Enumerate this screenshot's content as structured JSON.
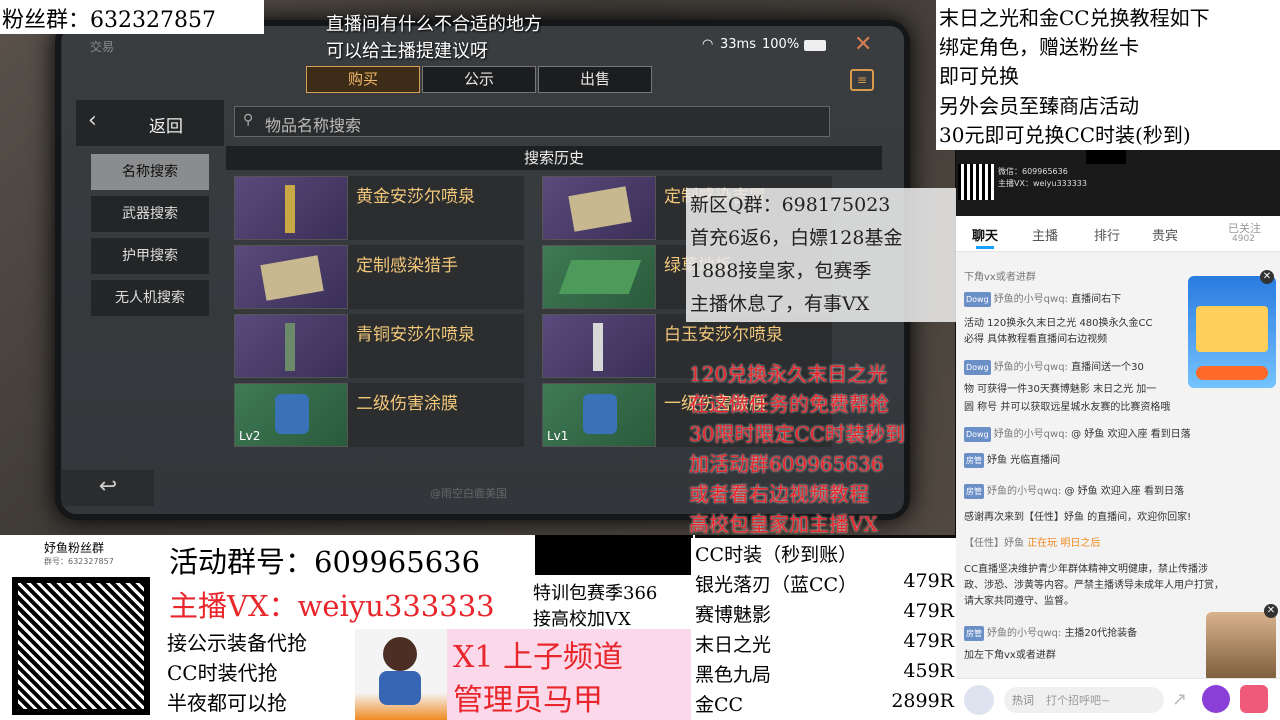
{
  "game": {
    "window_title": "交易",
    "ping": "33ms",
    "battery": "100%",
    "tabs": [
      {
        "label": "购买"
      },
      {
        "label": "公示"
      },
      {
        "label": "出售"
      }
    ],
    "back_label": "返回",
    "search_placeholder": "物品名称搜索",
    "history_title": "搜索历史",
    "side_items": [
      {
        "label": "名称搜索"
      },
      {
        "label": "武器搜索"
      },
      {
        "label": "护甲搜索"
      },
      {
        "label": "无人机搜索"
      }
    ],
    "items": [
      {
        "name": "黄金安莎尔喷泉",
        "level": ""
      },
      {
        "name": "定制感染吉冒",
        "level": ""
      },
      {
        "name": "定制感染猎手",
        "level": ""
      },
      {
        "name": "绿草地板",
        "level": ""
      },
      {
        "name": "青铜安莎尔喷泉",
        "level": ""
      },
      {
        "name": "白玉安莎尔喷泉",
        "level": ""
      },
      {
        "name": "二级伤害涂膜",
        "level": "Lv2"
      },
      {
        "name": "一级伤害涂膜",
        "level": "Lv1"
      }
    ],
    "bottom_hint": "@雨空白鹿美国"
  },
  "overlay": {
    "fan_group": "粉丝群：632327857",
    "top_notice": [
      "直播间有什么不合适的地方",
      "可以给主播提建议呀"
    ],
    "right_top": [
      "末日之光和金CC兑换教程如下",
      "绑定角色，赠送粉丝卡",
      "即可兑换",
      "另外会员至臻商店活动",
      "30元即可兑换CC时装(秒到)"
    ],
    "mid_block": [
      "新区Q群：698175023",
      "首充6返6，白嫖128基金",
      "1888接皇家，包赛季",
      "主播休息了，有事VX"
    ],
    "red_block": [
      "120兑换永久末日之光",
      "在这做任务的免费帮抢",
      "30限时限定CC时装秒到",
      "加活动群609965636",
      "或者看右边视频教程",
      "高校包皇家加主播VX"
    ],
    "qr_title": "妤鱼粉丝群",
    "qr_sub": "群号：632327857",
    "activity_group": "活动群号：609965636",
    "anchor_vx": "主播VX：weiyu333333",
    "services": [
      "接公示装备代抢",
      "CC时装代抢",
      "半夜都可以抢"
    ],
    "training": [
      "特训包赛季366",
      "接高校加VX"
    ],
    "channel_banner": [
      "X1 上子频道",
      "管理员马甲"
    ],
    "price_title": "CC时装（秒到账）",
    "prices": [
      {
        "name": "银光落刃（蓝CC）",
        "price": "479R"
      },
      {
        "name": "赛博魅影",
        "price": "479R"
      },
      {
        "name": "末日之光",
        "price": "479R"
      },
      {
        "name": "黑色九局",
        "price": "459R"
      },
      {
        "name": "金CC",
        "price": "2899R"
      }
    ]
  },
  "chat": {
    "tabs": [
      {
        "label": "聊天"
      },
      {
        "label": "主播"
      },
      {
        "label": "排行"
      },
      {
        "label": "贵宾"
      }
    ],
    "follow_label": "已关注",
    "follow_count": "4902",
    "mini_qq": "微信：609965636",
    "mini_vx": "主播VX：weiyu333333",
    "notice": "下角vx或者进群",
    "messages": [
      {
        "badge": "Dowg",
        "user": "妤鱼的小号qwq:",
        "text": "直播间右下"
      },
      {
        "badge": "",
        "user": "",
        "text": "活动 120换永久末日之光 480换永久金CC"
      },
      {
        "badge": "",
        "user": "",
        "text": "必得 具体教程看直播间右边视频"
      },
      {
        "badge": "Dowg",
        "user": "妤鱼的小号qwq:",
        "text": "直播间送一个30"
      },
      {
        "badge": "",
        "user": "",
        "text": "物 可获得一件30天赛博魅影 末日之光 加一"
      },
      {
        "badge": "",
        "user": "",
        "text": "圆 称号 并可以获取远星城水友赛的比赛资格哦"
      },
      {
        "badge": "Dowg",
        "user": "妤鱼的小号qwq:",
        "text": "@ 妤鱼 欢迎入座 看到日落"
      },
      {
        "badge": "房管",
        "user": "",
        "text": "妤鱼 光临直播间"
      },
      {
        "badge": "房管",
        "user": "妤鱼的小号qwq:",
        "text": "@ 妤鱼 欢迎入座 看到日落"
      },
      {
        "badge": "",
        "user": "",
        "text": "感谢再次来到【任性】妤鱼 的直播间，欢迎你回家!"
      },
      {
        "badge": "",
        "user": "【任性】妤鱼",
        "text": "正在玩 明日之后"
      },
      {
        "badge": "",
        "user": "",
        "text": "CC直播坚决维护青少年群体精神文明健康，禁止传播涉"
      },
      {
        "badge": "",
        "user": "",
        "text": "政、涉恐、涉黄等内容。严禁主播诱导未成年人用户打赏，"
      },
      {
        "badge": "",
        "user": "",
        "text": "请大家共同遵守、监督。"
      },
      {
        "badge": "房管",
        "user": "妤鱼的小号qwq:",
        "text": "主播20代抢装备"
      },
      {
        "badge": "",
        "user": "",
        "text": "加左下角vx或者进群"
      }
    ],
    "input_hint": "打个招呼吧~",
    "input_prefix": "热词"
  }
}
